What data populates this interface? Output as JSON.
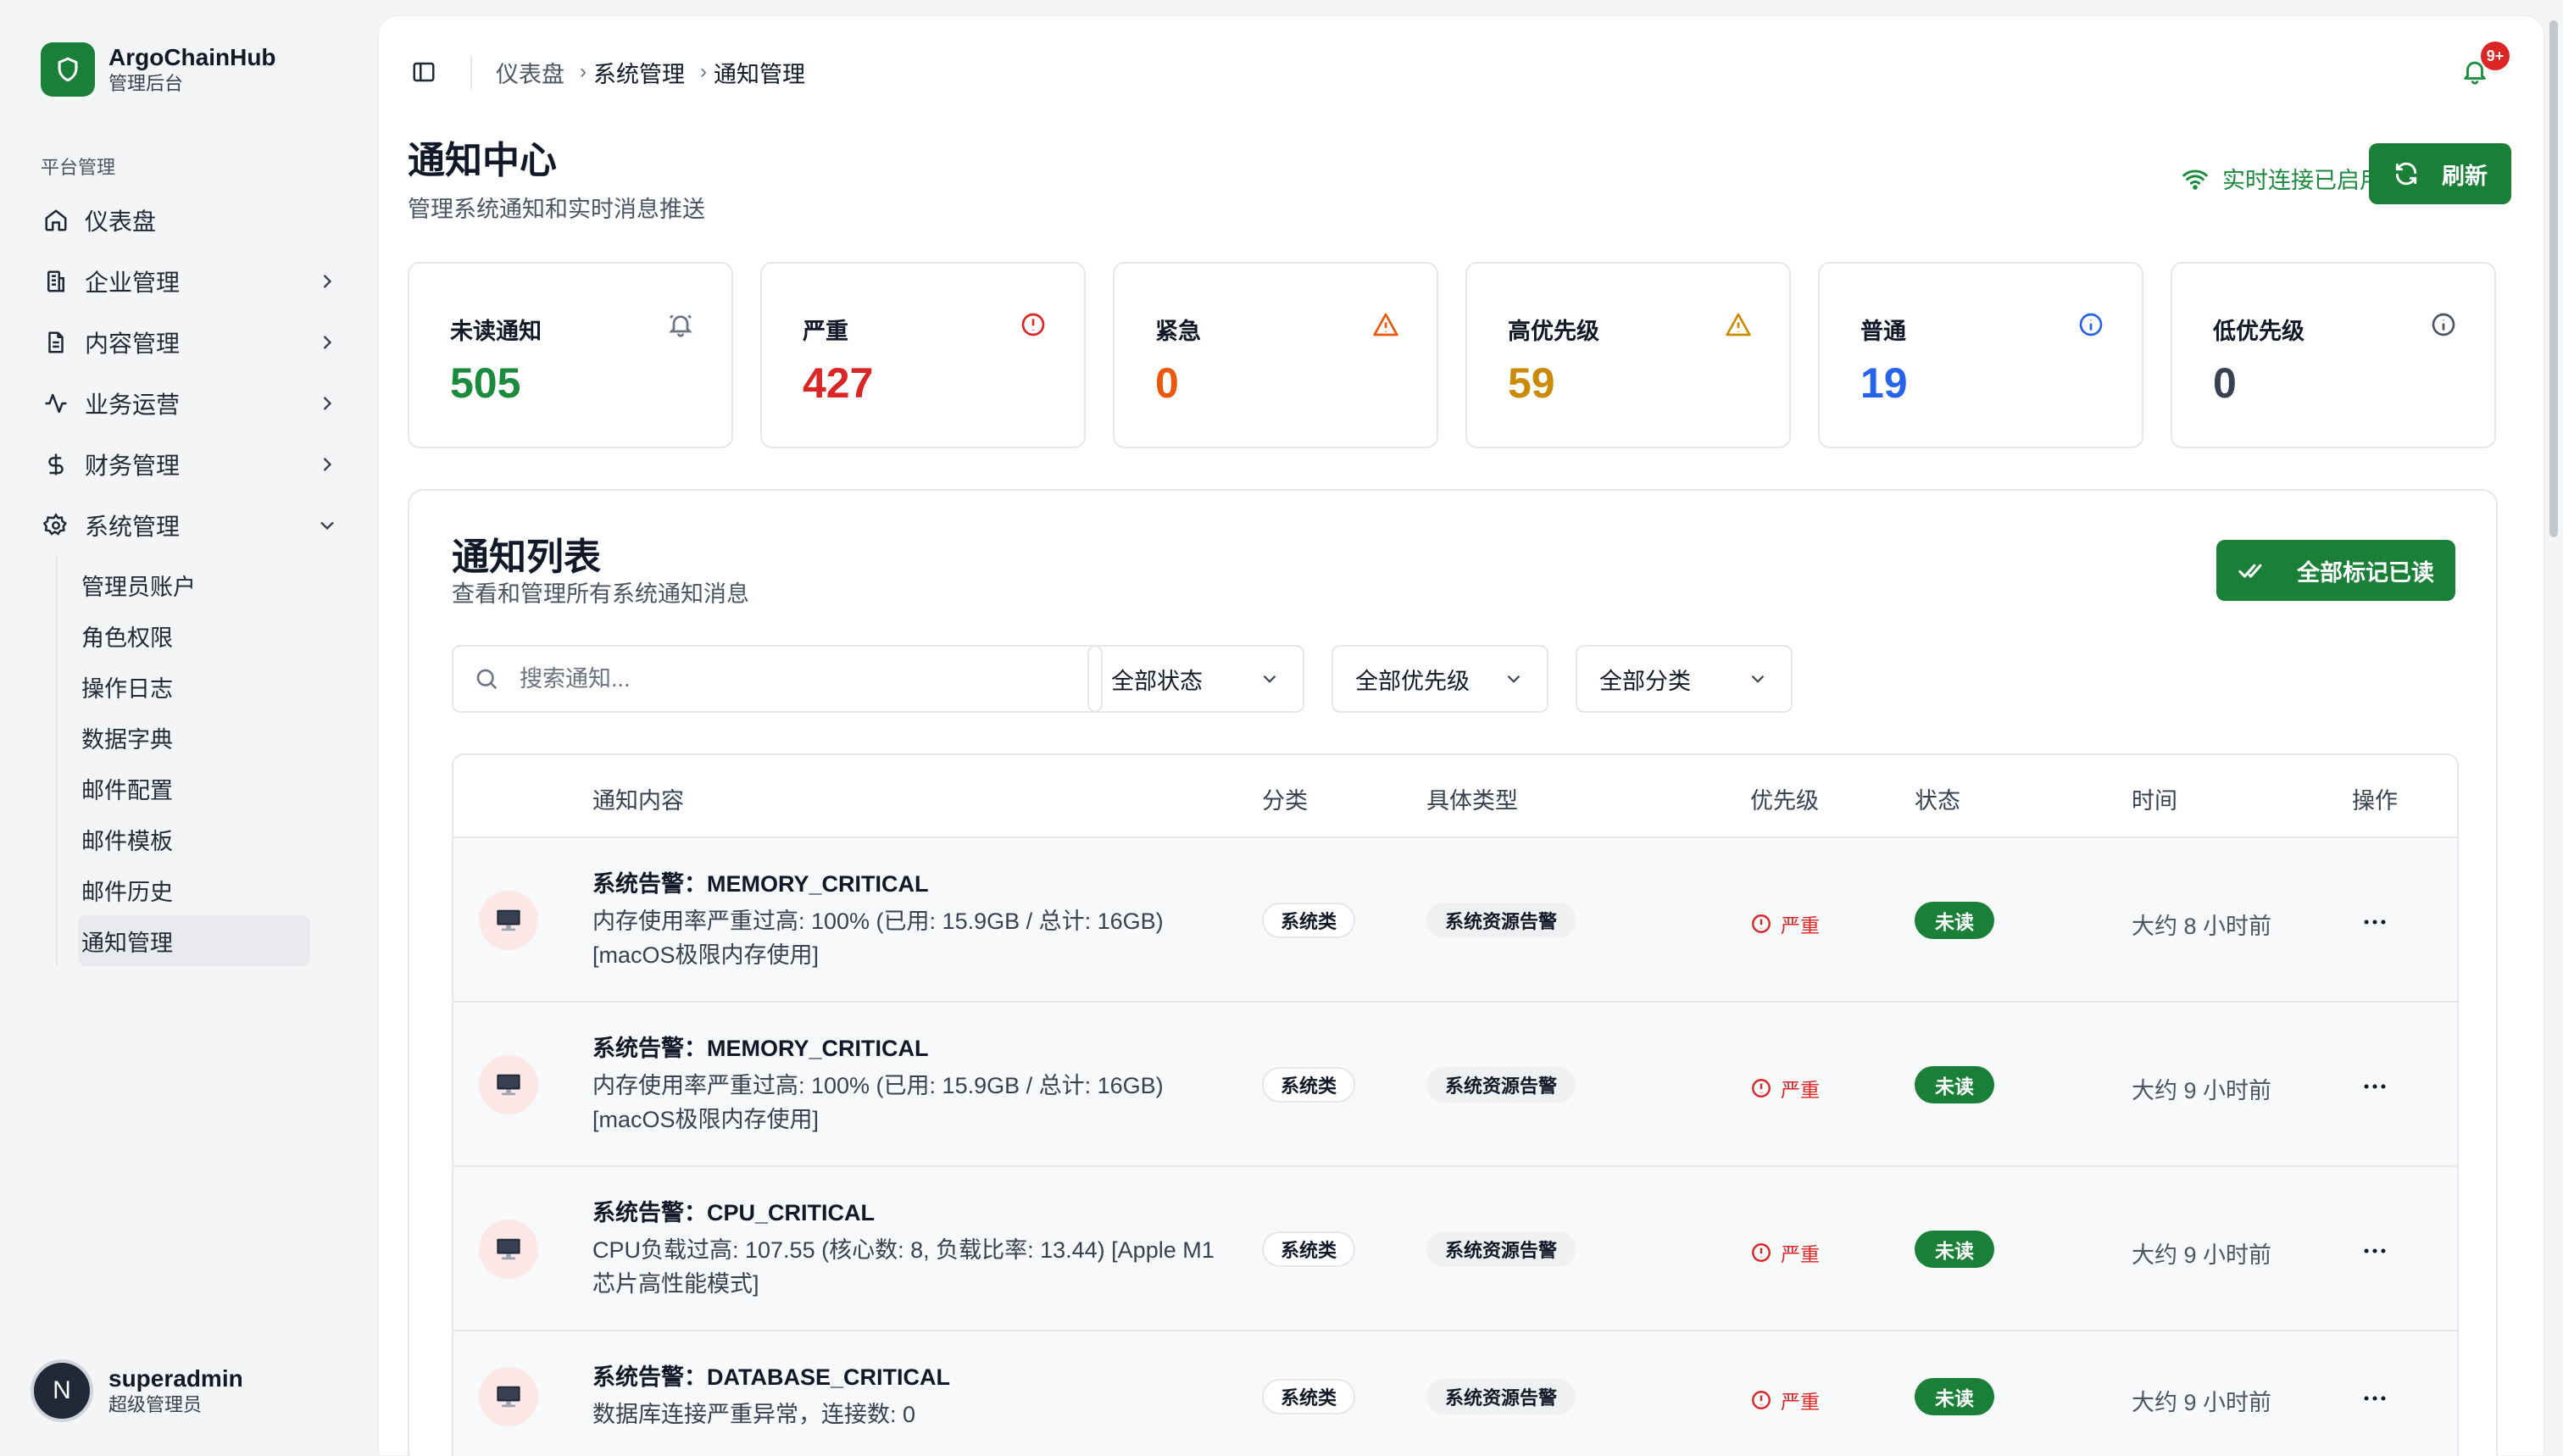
{
  "brand": {
    "name": "ArgoChainHub",
    "subtitle": "管理后台",
    "color": "#1a7f37"
  },
  "sidebar": {
    "section_label": "平台管理",
    "items": [
      {
        "label": "仪表盘",
        "icon": "home-icon"
      },
      {
        "label": "企业管理",
        "icon": "building-icon"
      },
      {
        "label": "内容管理",
        "icon": "document-icon"
      },
      {
        "label": "业务运营",
        "icon": "activity-icon"
      },
      {
        "label": "财务管理",
        "icon": "dollar-icon"
      },
      {
        "label": "系统管理",
        "icon": "gear-icon"
      }
    ],
    "sub_items": [
      "管理员账户",
      "角色权限",
      "操作日志",
      "数据字典",
      "邮件配置",
      "邮件模板",
      "邮件历史",
      "通知管理"
    ],
    "active_sub": "通知管理"
  },
  "user": {
    "initial": "N",
    "name": "superadmin",
    "role": "超级管理员"
  },
  "breadcrumb": [
    "仪表盘",
    "系统管理",
    "通知管理"
  ],
  "bell_badge": "9+",
  "page": {
    "title": "通知中心",
    "subtitle": "管理系统通知和实时消息推送"
  },
  "live_status": "实时连接已启用",
  "refresh_label": "刷新",
  "stats": [
    {
      "label": "未读通知",
      "value": "505",
      "color": "#1a8a3c",
      "icon": "bell-icon"
    },
    {
      "label": "严重",
      "value": "427",
      "color": "#dc2626",
      "icon": "alert-circle-icon"
    },
    {
      "label": "紧急",
      "value": "0",
      "color": "#ea580c",
      "icon": "warning-triangle-icon"
    },
    {
      "label": "高优先级",
      "value": "59",
      "color": "#ca8a04",
      "icon": "warning-triangle-icon"
    },
    {
      "label": "普通",
      "value": "19",
      "color": "#2563eb",
      "icon": "info-icon"
    },
    {
      "label": "低优先级",
      "value": "0",
      "color": "#374151",
      "icon": "info-icon"
    }
  ],
  "list": {
    "title": "通知列表",
    "subtitle": "查看和管理所有系统通知消息",
    "mark_all_label": "全部标记已读",
    "search_placeholder": "搜索通知...",
    "filters": [
      "全部状态",
      "全部优先级",
      "全部分类"
    ],
    "columns": [
      "通知内容",
      "分类",
      "具体类型",
      "优先级",
      "状态",
      "时间",
      "操作"
    ],
    "rows": [
      {
        "title": "系统告警：MEMORY_CRITICAL",
        "desc": "内存使用率严重过高: 100% (已用: 15.9GB / 总计: 16GB) [macOS极限内存使用]",
        "category": "系统类",
        "type": "系统资源告警",
        "priority": "严重",
        "status": "未读",
        "time": "大约 8 小时前"
      },
      {
        "title": "系统告警：MEMORY_CRITICAL",
        "desc": "内存使用率严重过高: 100% (已用: 15.9GB / 总计: 16GB) [macOS极限内存使用]",
        "category": "系统类",
        "type": "系统资源告警",
        "priority": "严重",
        "status": "未读",
        "time": "大约 9 小时前"
      },
      {
        "title": "系统告警：CPU_CRITICAL",
        "desc": "CPU负载过高: 107.55 (核心数: 8, 负载比率: 13.44) [Apple M1芯片高性能模式]",
        "category": "系统类",
        "type": "系统资源告警",
        "priority": "严重",
        "status": "未读",
        "time": "大约 9 小时前"
      },
      {
        "title": "系统告警：DATABASE_CRITICAL",
        "desc": "数据库连接严重异常，连接数: 0",
        "category": "系统类",
        "type": "系统资源告警",
        "priority": "严重",
        "status": "未读",
        "time": "大约 9 小时前"
      }
    ]
  }
}
